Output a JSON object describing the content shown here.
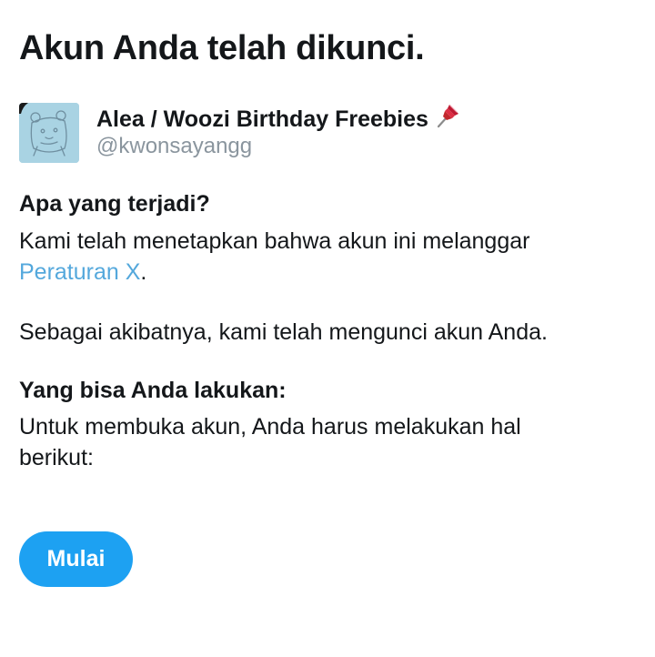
{
  "page": {
    "title": "Akun Anda telah dikunci."
  },
  "account": {
    "display_name": "Alea / Woozi Birthday Freebies",
    "display_name_icon": "pushpin-icon",
    "handle": "@kwonsayangg",
    "avatar_color": "#a9d3e3"
  },
  "what_happened": {
    "heading": "Apa yang terjadi?",
    "text_before_link": "Kami telah menetapkan bahwa akun ini melanggar ",
    "link_label": "Peraturan X",
    "text_after_link": ".",
    "consequence": "Sebagai akibatnya, kami telah mengunci akun Anda."
  },
  "what_you_can_do": {
    "heading": "Yang bisa Anda lakukan:",
    "text": "Untuk membuka akun, Anda harus melakukan hal berikut:"
  },
  "actions": {
    "start_label": "Mulai"
  },
  "colors": {
    "text": "#14171a",
    "muted": "#8a959e",
    "link": "#54a8dc",
    "button": "#1da1f2"
  }
}
